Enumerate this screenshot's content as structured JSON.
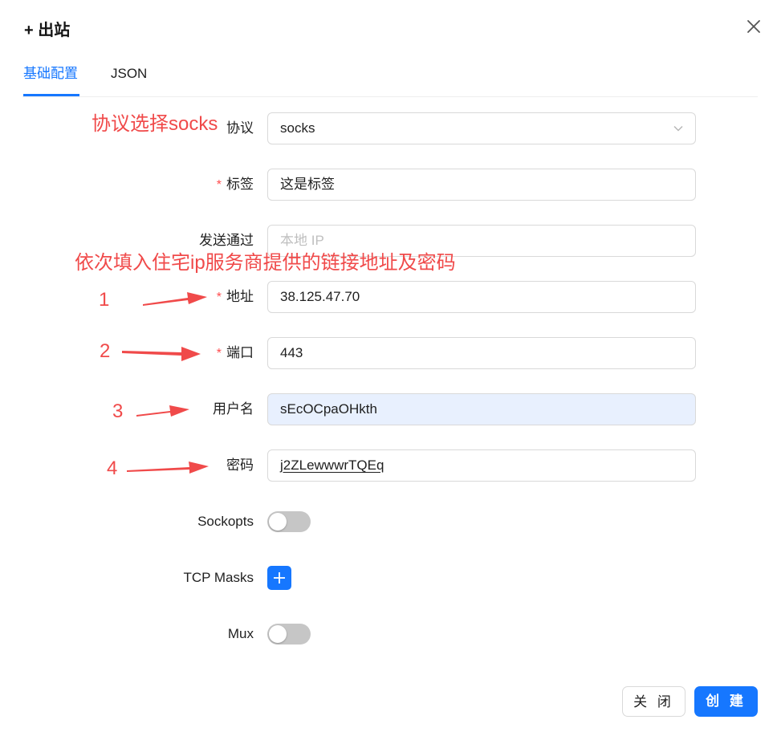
{
  "modal": {
    "title": "+ 出站",
    "close_icon": "close-icon"
  },
  "tabs": [
    {
      "label": "基础配置",
      "active": true
    },
    {
      "label": "JSON",
      "active": false
    }
  ],
  "form": {
    "protocol": {
      "label": "协议",
      "value": "socks",
      "required": false
    },
    "tag": {
      "label": "标签",
      "value": "这是标签",
      "required": true
    },
    "send_through": {
      "label": "发送通过",
      "value": "",
      "placeholder": "本地 IP",
      "required": false
    },
    "address": {
      "label": "地址",
      "value": "38.125.47.70",
      "required": true
    },
    "port": {
      "label": "端口",
      "value": "443",
      "required": true
    },
    "username": {
      "label": "用户名",
      "value": "sEcOCpaOHkth",
      "required": false
    },
    "password": {
      "label": "密码",
      "value": "j2ZLewwwrTQEq",
      "required": false
    },
    "sockopts": {
      "label": "Sockopts",
      "enabled": false
    },
    "tcp_masks": {
      "label": "TCP Masks",
      "add_icon": "plus-icon"
    },
    "mux": {
      "label": "Mux",
      "enabled": false
    }
  },
  "required_mark": "*",
  "annotations": {
    "protocol_note": "协议选择socks",
    "fill_note": "依次填入住宅ip服务商提供的链接地址及密码",
    "steps": [
      "1",
      "2",
      "3",
      "4"
    ]
  },
  "footer": {
    "close_label": "关 闭",
    "create_label": "创 建"
  },
  "colors": {
    "primary": "#1677ff",
    "required": "#ff4d4f",
    "annotation": "#f04a4a",
    "autofill_bg": "#e8f0fe"
  }
}
